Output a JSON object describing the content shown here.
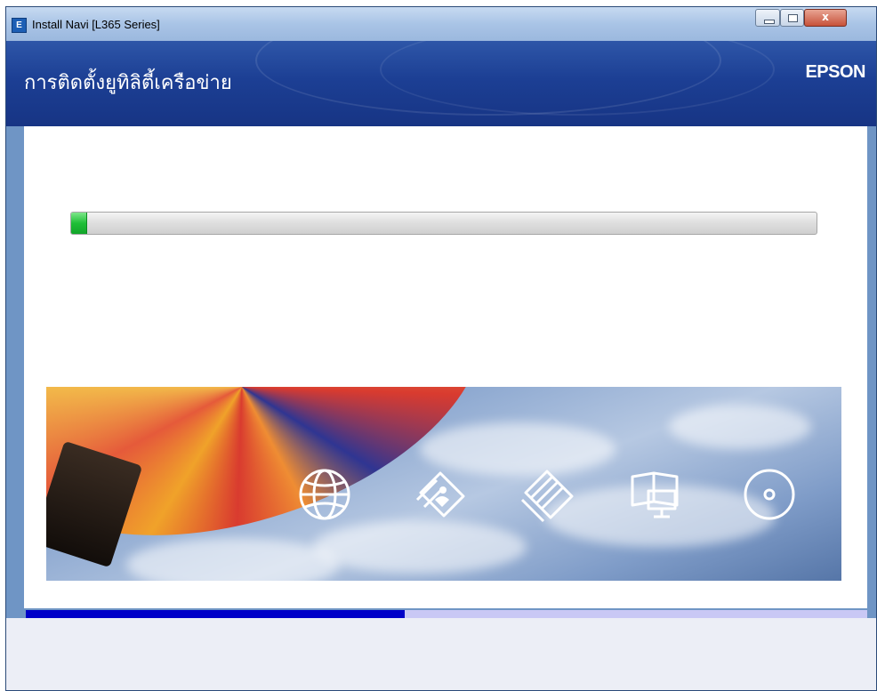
{
  "window": {
    "title": "Install Navi [L365 Series]",
    "app_icon_letter": "E",
    "close_glyph": "x"
  },
  "header": {
    "title": "การติดตั้งยูทิลิตี้เครือข่าย",
    "brand": "EPSON",
    "background_color": "#1c3f94"
  },
  "install_progress": {
    "percent": 2,
    "fill_color": "#1fbf37"
  },
  "banner": {
    "icons": [
      "globe-icon",
      "photos-icon",
      "documents-icon",
      "manual-monitor-icon",
      "disc-icon"
    ]
  },
  "step_progress": {
    "percent": 45,
    "fill_color": "#0000c8",
    "track_color": "#c9c8f5"
  }
}
